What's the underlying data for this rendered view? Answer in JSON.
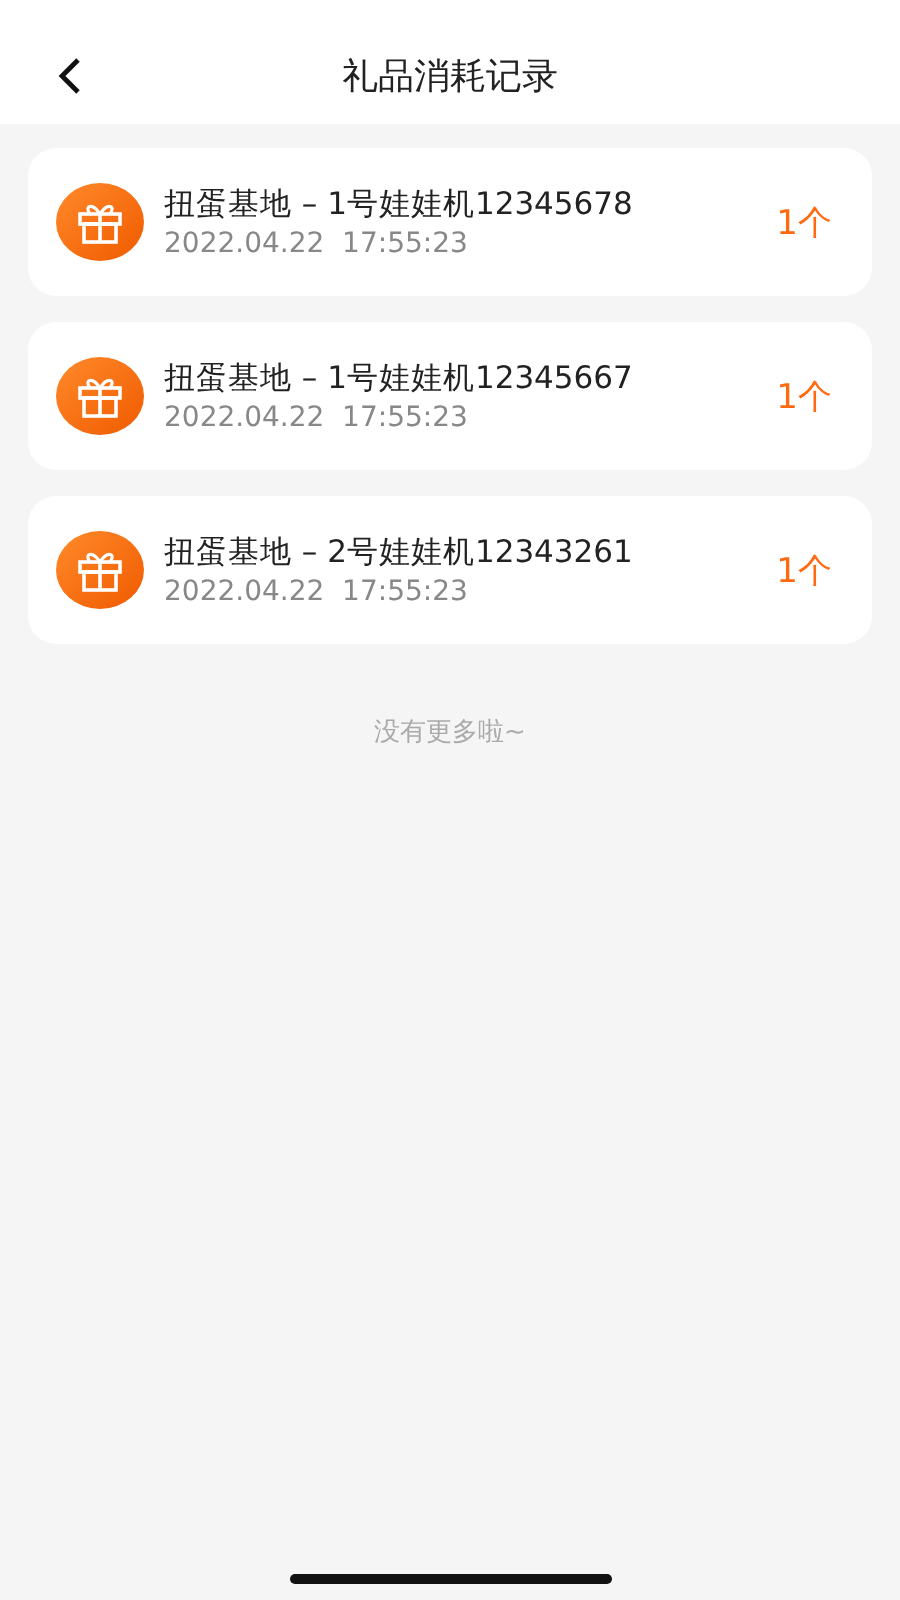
{
  "header": {
    "title": "礼品消耗记录"
  },
  "records": [
    {
      "title": "扭蛋基地 – 1号娃娃机12345678",
      "time": "2022.04.22  17:55:23",
      "count": "1个"
    },
    {
      "title": "扭蛋基地 – 1号娃娃机12345667",
      "time": "2022.04.22  17:55:23",
      "count": "1个"
    },
    {
      "title": "扭蛋基地 – 2号娃娃机12343261",
      "time": "2022.04.22  17:55:23",
      "count": "1个"
    }
  ],
  "footer": "没有更多啦~"
}
